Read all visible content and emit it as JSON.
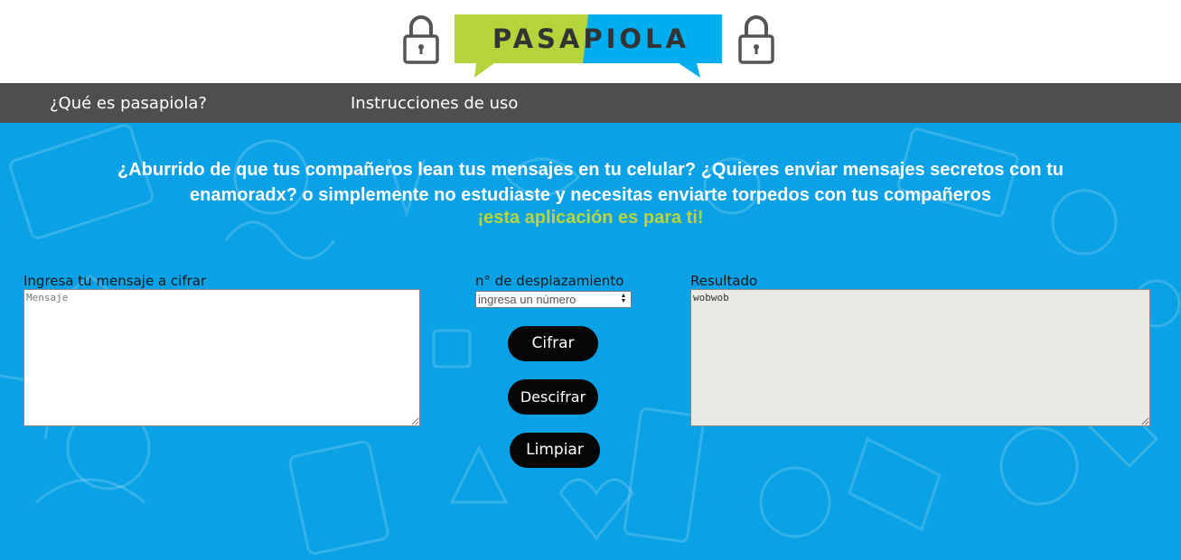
{
  "header": {
    "logo_text": "PASAPIOLA",
    "icons": [
      "lock-icon",
      "lock-icon"
    ]
  },
  "nav": {
    "items": [
      {
        "label": "¿Qué es pasapiola?"
      },
      {
        "label": "Instrucciones de uso"
      }
    ]
  },
  "hero": {
    "headline_line1": "¿Aburrido de que tus compañeros lean tus mensajes en tu celular? ¿Quieres enviar mensajes secretos con tu",
    "headline_line2": "enamoradx? o simplemente no estudiaste y necesitas enviarte torpedos con tus compañeros",
    "highlight": "¡esta aplicación es para ti!"
  },
  "form": {
    "message_label": "Ingresa tu mensaje a cifrar",
    "message_placeholder": "Mensaje",
    "shift_label": "n° de desplazamiento",
    "shift_placeholder": "ingresa un número",
    "result_label": "Resultado",
    "result_value": "wobwob"
  },
  "buttons": {
    "cipher": "Cifrar",
    "decipher": "Descifrar",
    "clear": "Limpiar"
  },
  "colors": {
    "nav_bg": "#4d4e50",
    "main_bg": "#0aa1e6",
    "logo_green": "#b5d43b",
    "logo_blue": "#00aeef",
    "highlight": "#b9d53a",
    "button_bg": "#050505"
  }
}
